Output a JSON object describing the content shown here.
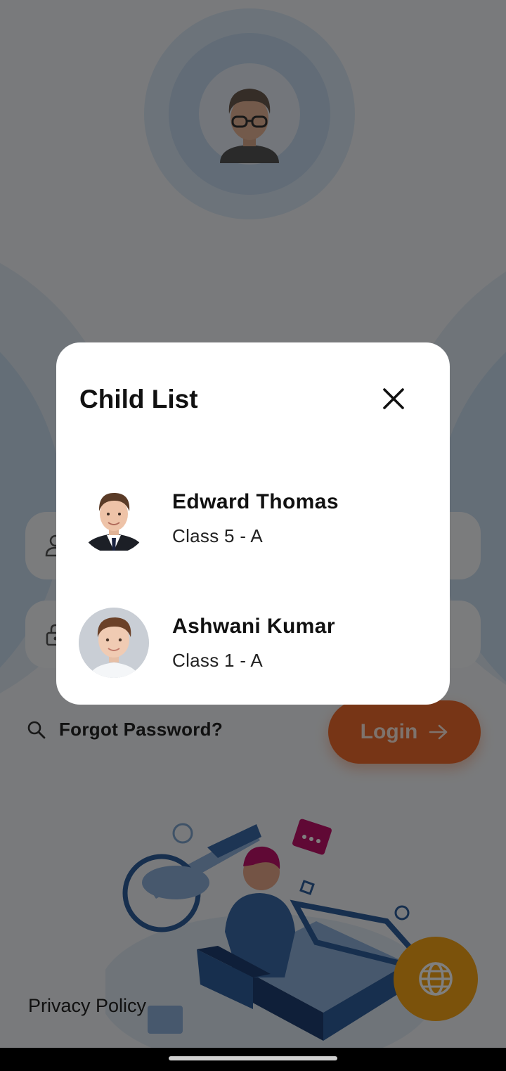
{
  "login": {
    "forgot_password": "Forgot Password?",
    "login_button": "Login",
    "privacy_policy": "Privacy Policy"
  },
  "dialog": {
    "title": "Child List",
    "children": [
      {
        "name": "Edward Thomas",
        "class": "Class 5 - A"
      },
      {
        "name": "Ashwani Kumar",
        "class": "Class 1 - A"
      }
    ]
  },
  "icons": {
    "user": "user-icon",
    "lock": "lock-icon",
    "search": "search-icon",
    "arrow": "arrow-right-icon",
    "globe": "globe-icon",
    "close": "close-icon"
  },
  "colors": {
    "accent": "#ef6a2c",
    "globe_button": "#f6a517",
    "ring": "#c4d9ee"
  }
}
